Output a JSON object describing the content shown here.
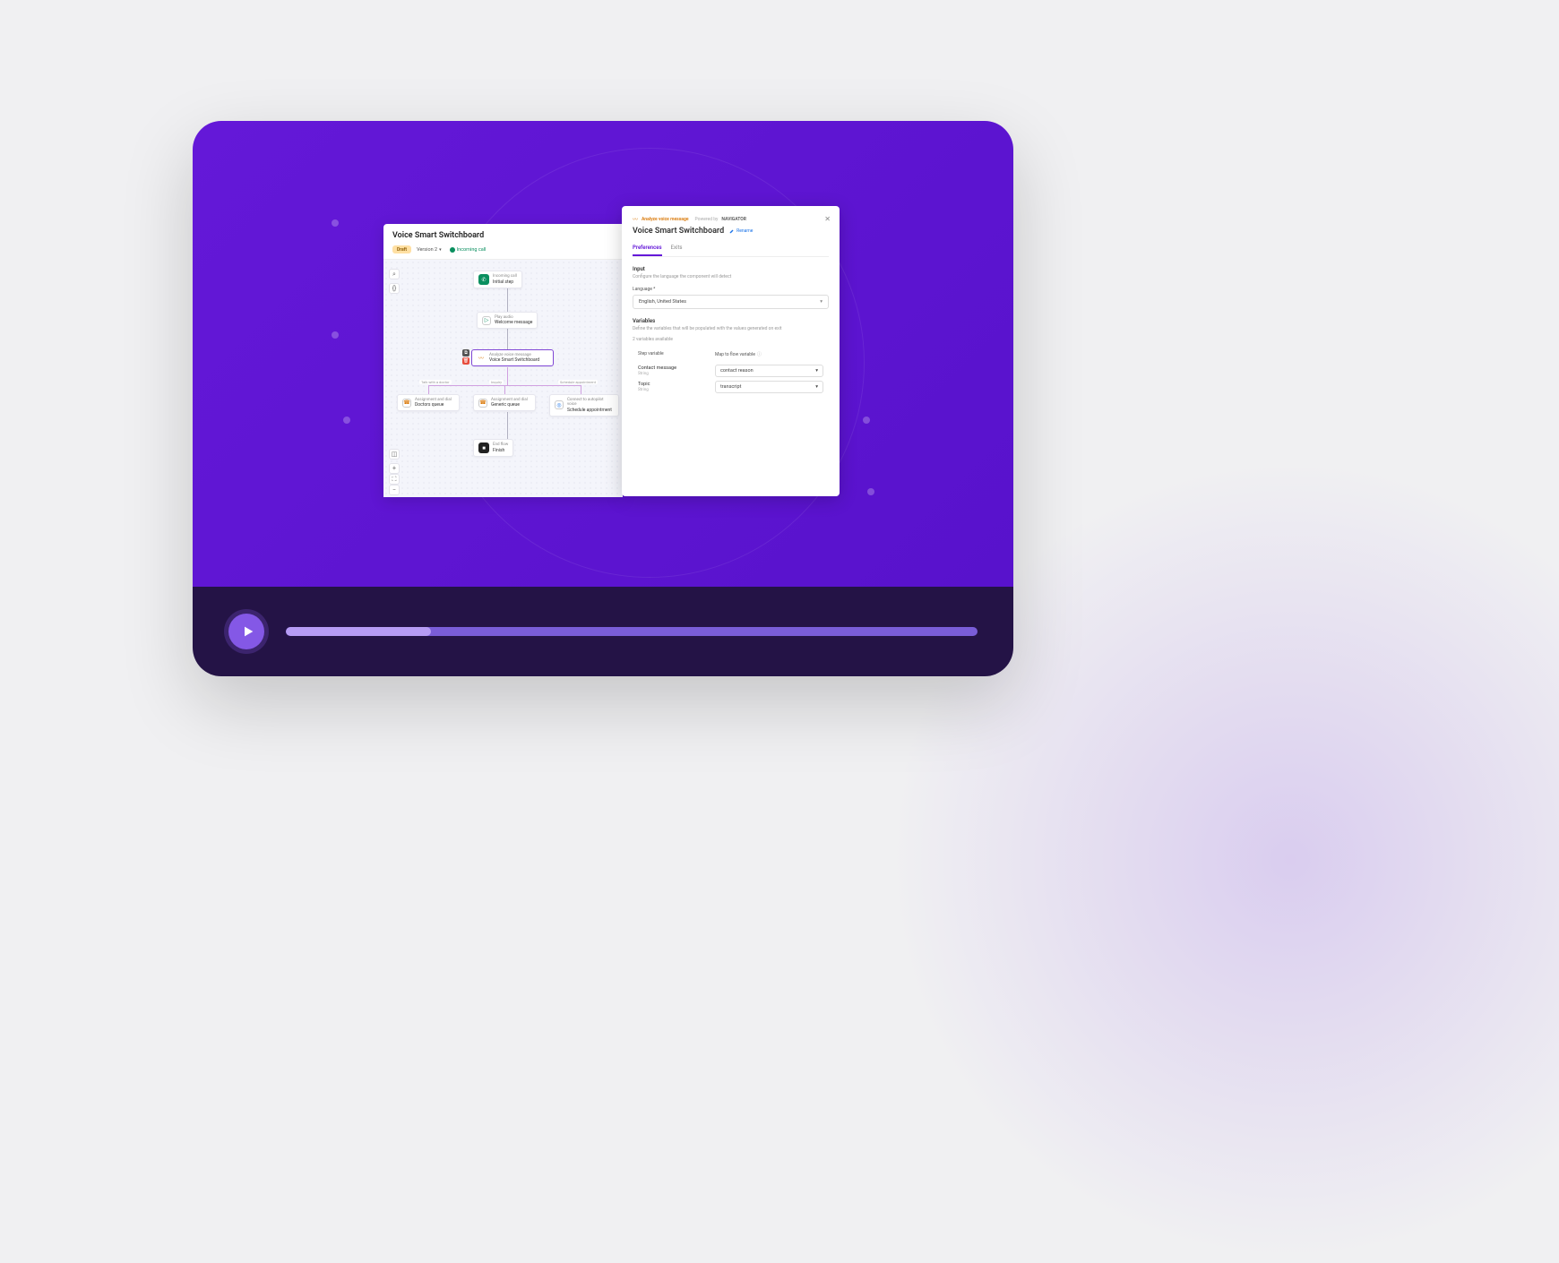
{
  "flow": {
    "title": "Voice Smart Switchboard",
    "draft": "Draft",
    "version": "Version 2",
    "trigger": "Incoming call",
    "nodes": {
      "start": {
        "label": "Incoming call",
        "sub": "Initial step"
      },
      "welcome": {
        "label": "Play audio",
        "sub": "Welcome message"
      },
      "analyze": {
        "label": "Analyze voice message",
        "sub": "Voice Smart Switchboard"
      },
      "d1": {
        "label": "Assignment and dial",
        "sub": "Doctors queue"
      },
      "d2": {
        "label": "Assignment and dial",
        "sub": "Generic queue"
      },
      "d3": {
        "label": "Connect to autopilot voice",
        "sub": "Schedule appointment"
      },
      "end": {
        "label": "End flow",
        "sub": "Finish"
      }
    },
    "branches": {
      "b1": "Talk with a doctor",
      "b2": "Inquiry",
      "b3": "Schedule appointment"
    }
  },
  "panel": {
    "headerStep": "Analyze voice message",
    "poweredBy": "Powered by",
    "brand": "NAVIGATOR",
    "title": "Voice Smart Switchboard",
    "rename": "Rename",
    "tabs": {
      "preferences": "Preferences",
      "exits": "Exits"
    },
    "input": {
      "heading": "Input",
      "help": "Configure the language the component will detect",
      "langLabel": "Language *",
      "langValue": "English, United States"
    },
    "variables": {
      "heading": "Variables",
      "help": "Define the variables that will be populated with the values generated on exit",
      "avail": "2 variables available",
      "col1": "Step variable",
      "col2": "Map to flow variable",
      "rows": [
        {
          "name": "Contact message",
          "type": "String",
          "value": "contact reason"
        },
        {
          "name": "Topic",
          "type": "String",
          "value": "transcript"
        }
      ]
    }
  },
  "player": {
    "progress": 21
  }
}
